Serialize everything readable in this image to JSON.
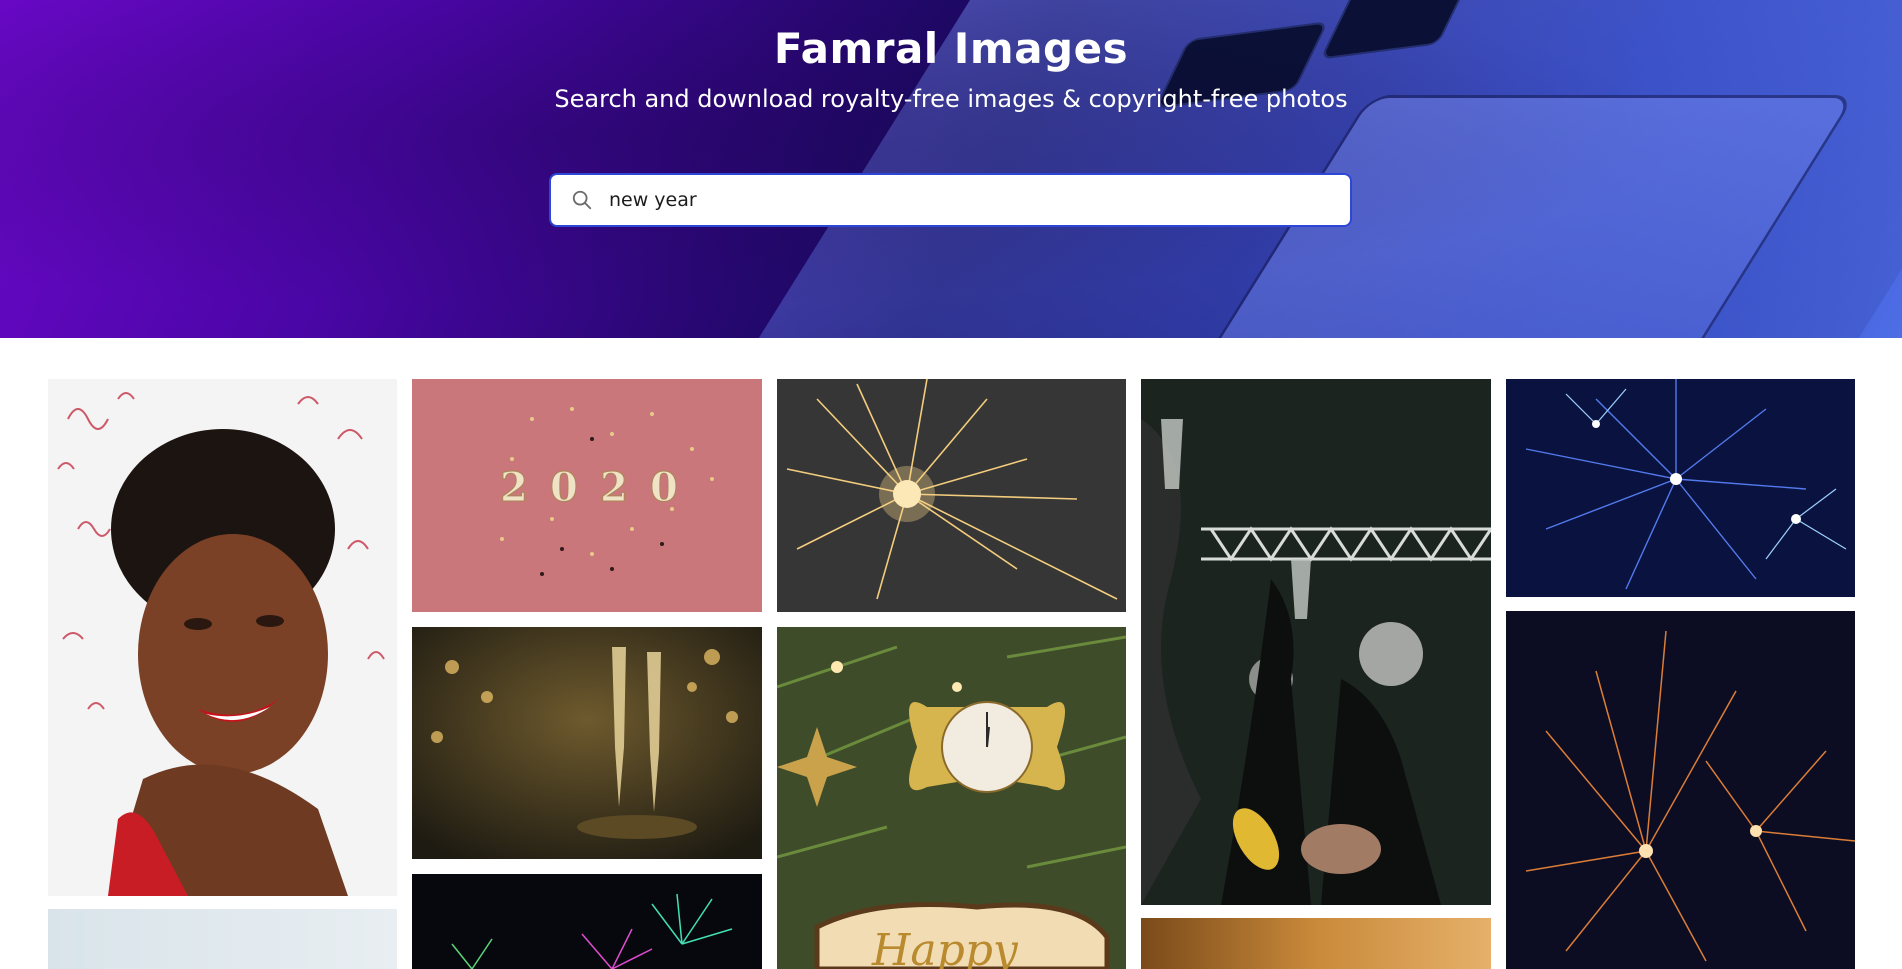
{
  "header": {
    "title": "Famral Images",
    "subtitle": "Search and download royalty-free images & copyright-free photos"
  },
  "search": {
    "value": "new year",
    "icon": "search-icon"
  },
  "gallery": {
    "images": [
      {
        "name": "woman-confetti-photo"
      },
      {
        "name": "2020-candles-glitter-photo"
      },
      {
        "name": "sparkler-photo"
      },
      {
        "name": "party-toast-crowd-photo"
      },
      {
        "name": "blue-fireworks-photo"
      },
      {
        "name": "champagne-glasses-photo"
      },
      {
        "name": "christmas-ornament-clock-photo"
      },
      {
        "name": "orange-fireworks-photo"
      },
      {
        "name": "colorful-fireworks-photo"
      },
      {
        "name": "light-sky-photo"
      },
      {
        "name": "golden-portrait-photo"
      }
    ],
    "sign_text": "Happy"
  }
}
